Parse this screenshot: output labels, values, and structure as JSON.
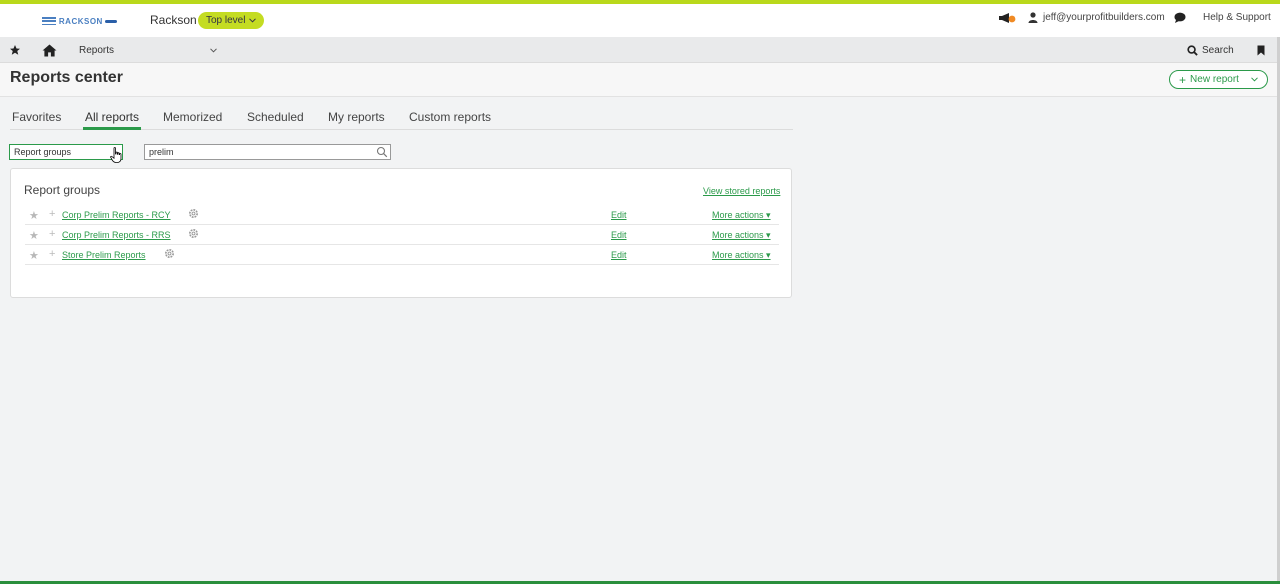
{
  "brand": {
    "logo_text": "RACKSON",
    "company": "Rackson",
    "level": "Top level",
    "accent": "#2b9a4a",
    "stripe": "#b9d81b"
  },
  "topbar": {
    "user_email": "jeff@yourprofitbuilders.com",
    "help": "Help & Support"
  },
  "navbar": {
    "reports": "Reports",
    "search": "Search"
  },
  "header": {
    "title": "Reports center",
    "new_report": "New report"
  },
  "tabs": [
    "Favorites",
    "All reports",
    "Memorized",
    "Scheduled",
    "My reports",
    "Custom reports"
  ],
  "filters": {
    "group_select": "Report groups",
    "search_value": "prelim"
  },
  "panel": {
    "title": "Report groups",
    "view_stored": "View stored reports",
    "edit_label": "Edit",
    "more_label": "More actions",
    "rows": [
      {
        "name": "Corp Prelim Reports - RCY"
      },
      {
        "name": "Corp Prelim Reports - RRS"
      },
      {
        "name": "Store Prelim Reports"
      }
    ]
  }
}
